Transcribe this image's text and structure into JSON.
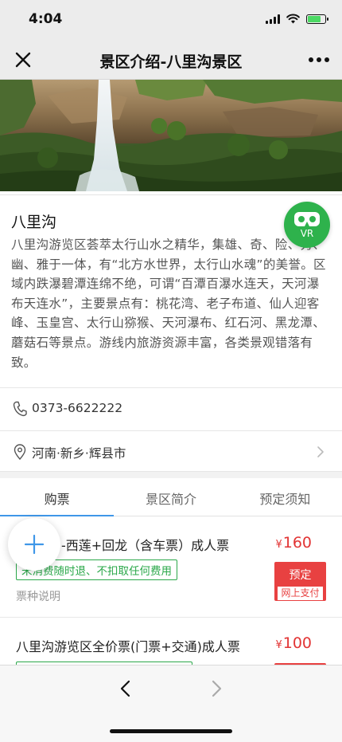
{
  "status_bar": {
    "time": "4:04",
    "icons": [
      "signal-icon",
      "wifi-icon",
      "battery-charging-icon"
    ],
    "battery_level": 0.75,
    "battery_color": "#4cd964"
  },
  "nav": {
    "title": "景区介绍-八里沟景区",
    "close_icon": "close-icon",
    "more_icon": "more-icon"
  },
  "hero": {
    "image": "waterfall-cliff-photo"
  },
  "intro": {
    "name": "八里沟",
    "description": "八里沟游览区荟萃太行山水之精华，集雄、奇、险、秀、幽、雅于一体，有“北方水世界，太行山水魂”的美誉。区域内跌瀑碧潭连绵不绝，可谓“百潭百瀑水连天，天河瀑布天连水”，主要景点有：桃花湾、老子布道、仙人迎客峰、玉皇宫、太行山猕猴、天河瀑布、红石河、黑龙潭、蘑菇石等景点。游线内旅游资源丰富，各类景观错落有致。",
    "vr_label": "VR",
    "vr_color": "#2eb24c"
  },
  "contact": {
    "phone": "0373-6622222",
    "address": "河南·新乡·辉县市"
  },
  "tabs": [
    {
      "label": "购票",
      "active": true
    },
    {
      "label": "景区简介",
      "active": false
    },
    {
      "label": "预定须知",
      "active": false
    }
  ],
  "tickets": [
    {
      "name": "-西莲+回龙（含车票）成人票",
      "tag": "未消费随时退、不扣取任何费用",
      "note": "票种说明",
      "currency": "¥",
      "price": "160",
      "book_label": "预定",
      "pay_label": "网上支付"
    },
    {
      "name": "八里沟游览区全价票(门票+交通)成人票",
      "tag": "",
      "currency": "¥",
      "price": "100",
      "book_label": "",
      "pay_label": ""
    }
  ],
  "colors": {
    "accent_tab": "#3f97e8",
    "price": "#e23434",
    "book_button": "#e84141",
    "tag_green": "#2ba84a"
  }
}
